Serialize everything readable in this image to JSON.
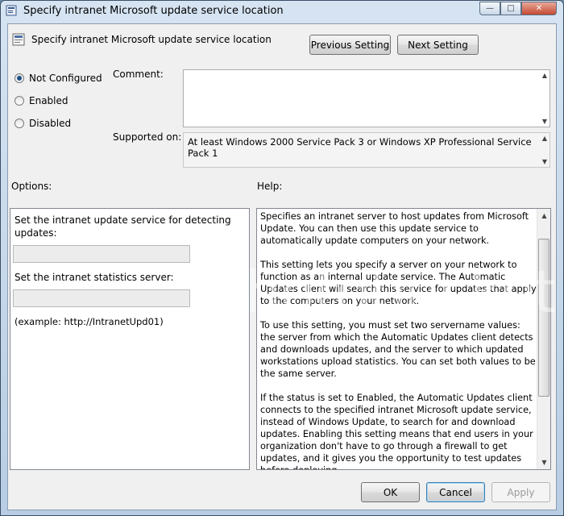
{
  "window": {
    "title": "Specify intranet Microsoft update service location",
    "minimize": "0",
    "maximize": "1",
    "close": "r"
  },
  "header": {
    "setting_title": "Specify intranet Microsoft update service location",
    "previous_label": "Previous Setting",
    "next_label": "Next Setting"
  },
  "state": {
    "options": [
      {
        "label": "Not Configured",
        "selected": true
      },
      {
        "label": "Enabled",
        "selected": false
      },
      {
        "label": "Disabled",
        "selected": false
      }
    ]
  },
  "comment": {
    "label": "Comment:",
    "value": ""
  },
  "supported": {
    "label": "Supported on:",
    "value": "At least Windows 2000 Service Pack 3 or Windows XP Professional Service Pack 1"
  },
  "options_panel": {
    "heading": "Options:",
    "detect_label": "Set the intranet update service for detecting updates:",
    "detect_value": "",
    "stats_label": "Set the intranet statistics server:",
    "stats_value": "",
    "example": "(example: http://IntranetUpd01)"
  },
  "help_panel": {
    "heading": "Help:",
    "paragraphs": [
      "Specifies an intranet server to host updates from Microsoft Update. You can then use this update service to automatically update computers on your network.",
      "This setting lets you specify a server on your network to function as an internal update service. The Automatic Updates client will search this service for updates that apply to the computers on your network.",
      "To use this setting, you must set two servername values: the server from which the Automatic Updates client detects and downloads updates, and the server to which updated workstations upload statistics. You can set both values to be the same server.",
      "If the status is set to Enabled, the Automatic Updates client connects to the specified intranet Microsoft update service, instead of Windows Update, to search for and download updates. Enabling this setting means that end users in your organization don't have to go through a firewall to get updates, and it gives you the opportunity to test updates before deploying"
    ]
  },
  "footer": {
    "ok_label": "OK",
    "cancel_label": "Cancel",
    "apply_label": "Apply"
  },
  "watermark": "photobucket"
}
